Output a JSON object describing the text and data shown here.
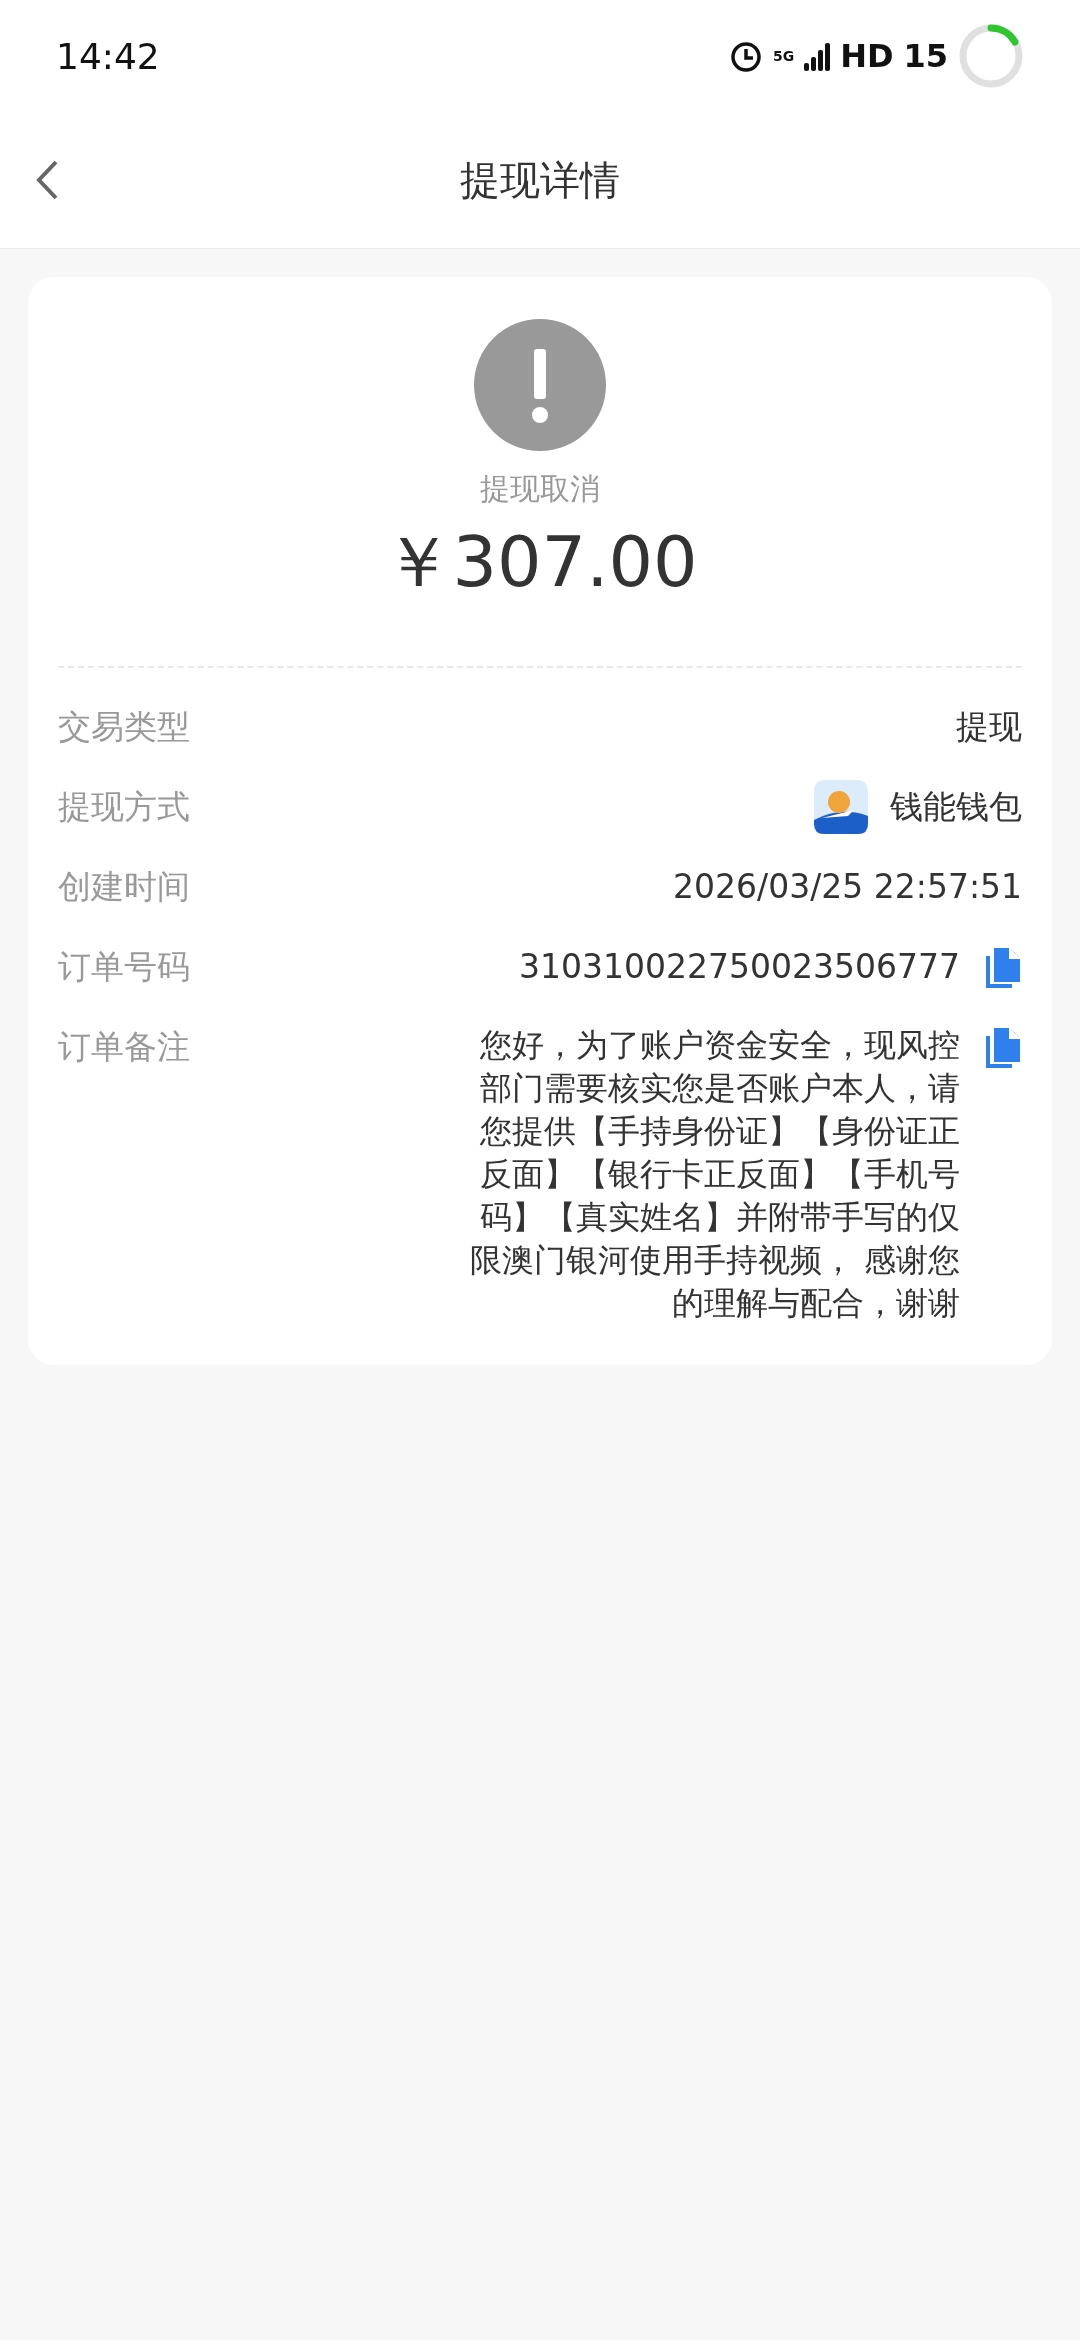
{
  "status_bar": {
    "time": "14:42",
    "network": "5G",
    "hd": "HD",
    "battery": "15"
  },
  "header": {
    "title": "提现详情"
  },
  "summary": {
    "status": "提现取消",
    "amount": "￥307.00"
  },
  "rows": [
    {
      "kind": "text",
      "label": "交易类型",
      "value": "提现"
    },
    {
      "kind": "app",
      "label": "提现方式",
      "value": "钱能钱包"
    },
    {
      "kind": "text",
      "label": "创建时间",
      "value": "2026/03/25 22:57:51"
    },
    {
      "kind": "copy",
      "label": "订单号码",
      "value": "310310022750023506777"
    },
    {
      "kind": "copy",
      "label": "订单备注",
      "value": "您好，为了账户资金安全，现风控部门需要核实您是否账户本人，请您提供【手持身份证】【身份证正反面】【银行卡正反面】【手机号码】【真实姓名】并附带手写的仅限澳门银河使用手持视频， 感谢您的理解与配合，谢谢"
    }
  ]
}
